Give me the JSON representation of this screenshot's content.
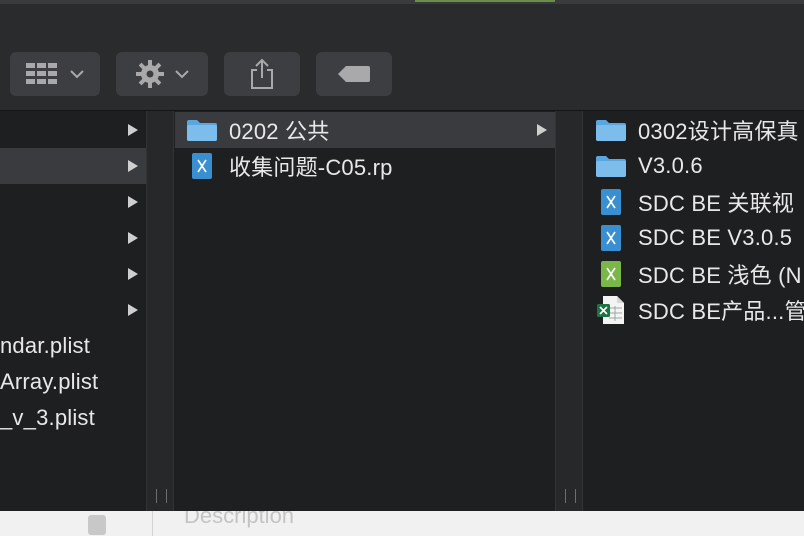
{
  "toolbar": {
    "buttons": [
      {
        "name": "view-options-button",
        "icon": "grid-view-icon"
      },
      {
        "name": "action-menu-button",
        "icon": "gear-icon"
      },
      {
        "name": "share-button",
        "icon": "share-icon"
      },
      {
        "name": "tag-button",
        "icon": "tag-icon"
      }
    ]
  },
  "column1": {
    "rows": [
      {
        "label": "",
        "has_children": true,
        "selected": false
      },
      {
        "label": "",
        "has_children": true,
        "selected": true
      },
      {
        "label": "",
        "has_children": true,
        "selected": false
      },
      {
        "label": "",
        "has_children": true,
        "selected": false
      },
      {
        "label": "",
        "has_children": true,
        "selected": false
      },
      {
        "label": "",
        "has_children": true,
        "selected": false
      },
      {
        "label": "ndar.plist",
        "has_children": false,
        "selected": false
      },
      {
        "label": "Array.plist",
        "has_children": false,
        "selected": false
      },
      {
        "label": "_v_3.plist",
        "has_children": false,
        "selected": false
      }
    ]
  },
  "column2": {
    "rows": [
      {
        "label": "0202 公共",
        "icon": "folder-icon",
        "has_children": true,
        "selected": true
      },
      {
        "label": "收集问题-C05.rp",
        "icon": "axure-file-icon",
        "has_children": false,
        "selected": false
      }
    ]
  },
  "column3": {
    "rows": [
      {
        "label": "0302设计高保真",
        "icon": "folder-icon"
      },
      {
        "label": "V3.0.6",
        "icon": "folder-icon"
      },
      {
        "label": "SDC BE  关联视",
        "icon": "axure-file-icon"
      },
      {
        "label": "SDC BE V3.0.5",
        "icon": "axure-file-icon"
      },
      {
        "label": "SDC BE 浅色 (N",
        "icon": "axure-green-file-icon"
      },
      {
        "label": "SDC BE产品...管",
        "icon": "excel-file-icon"
      }
    ]
  },
  "bottom": {
    "description_label": "Description"
  },
  "colors": {
    "folder": "#5aa7e0",
    "axure_blue": "#3a8fd1",
    "axure_green": "#7ab648",
    "excel": "#1f7244"
  }
}
